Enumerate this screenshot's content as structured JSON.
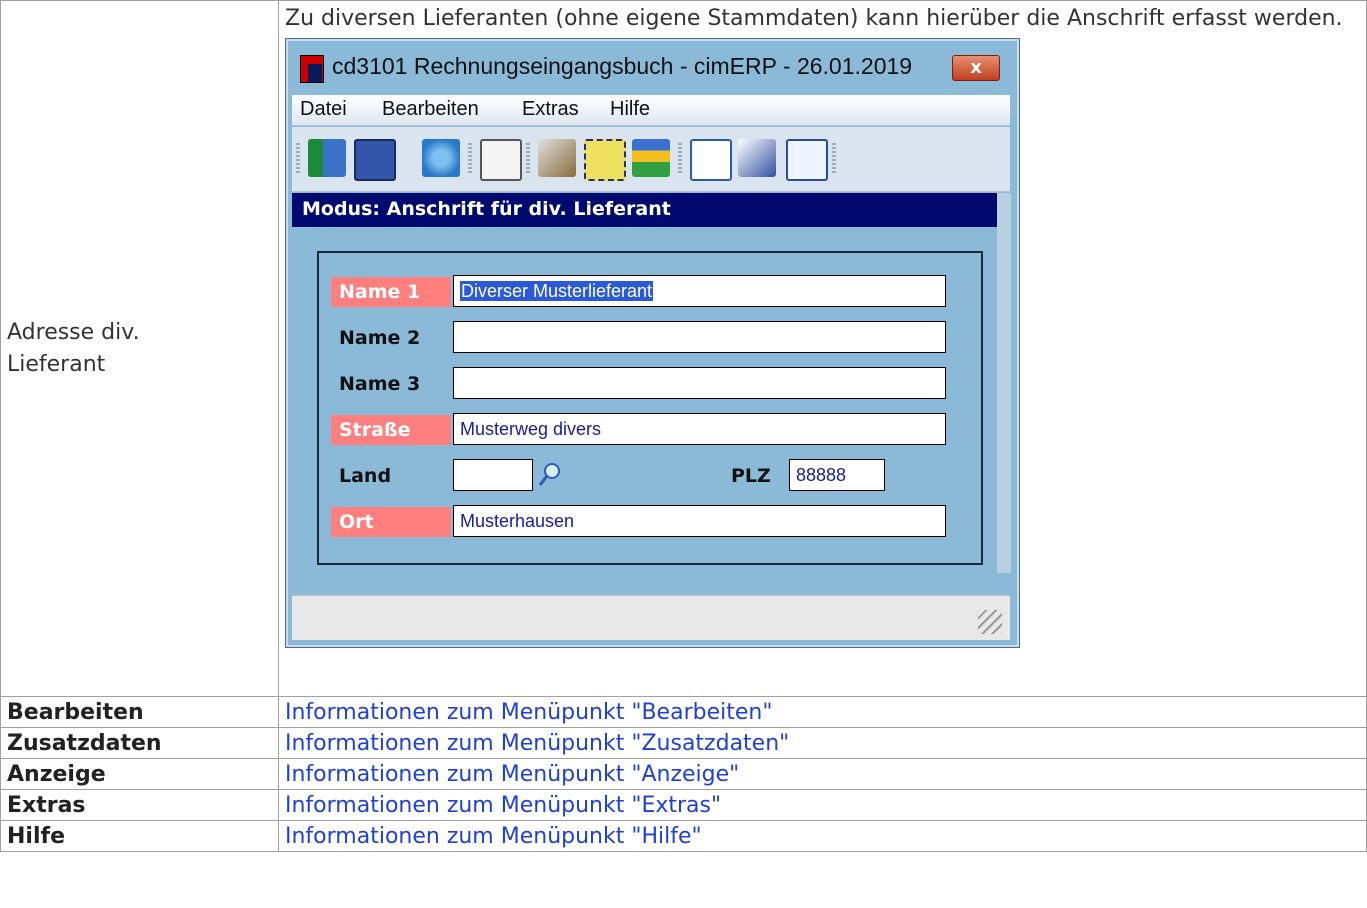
{
  "row_intro": {
    "label": "Adresse div. Lieferant",
    "description": "Zu diversen Lieferanten (ohne eigene Stammdaten) kann hierüber die Anschrift erfasst werden."
  },
  "window": {
    "title": "cd3101 Rechnungseingangsbuch - cimERP - 26.01.2019",
    "close_label": "x",
    "menu": [
      "Datei",
      "Bearbeiten",
      "Extras",
      "Hilfe"
    ],
    "toolbar_icons": [
      "exit-icon",
      "save-icon",
      "recycle-icon",
      "mail-icon",
      "edit-icon",
      "new-record-icon",
      "import-icon",
      "copy-windows-icon",
      "book-icon",
      "grid-icon"
    ],
    "mode": "Modus: Anschrift für div. Lieferant",
    "form": {
      "name1": {
        "label": "Name 1",
        "value": "Diverser Musterlieferant"
      },
      "name2": {
        "label": "Name 2",
        "value": ""
      },
      "name3": {
        "label": "Name 3",
        "value": ""
      },
      "strasse": {
        "label": "Straße",
        "value": "Musterweg divers"
      },
      "land": {
        "label": "Land",
        "value": ""
      },
      "plz": {
        "label": "PLZ",
        "value": "88888"
      },
      "ort": {
        "label": "Ort",
        "value": "Musterhausen"
      }
    },
    "colors": {
      "required_label": "#ff7f7f",
      "mode_bar": "#000a6e",
      "window_bg": "#8bb9d8"
    }
  },
  "rows": [
    {
      "label": "Bearbeiten",
      "link": "Informationen zum Menüpunkt \"Bearbeiten\""
    },
    {
      "label": "Zusatzdaten",
      "link": "Informationen zum Menüpunkt \"Zusatzdaten\""
    },
    {
      "label": "Anzeige",
      "link": "Informationen zum Menüpunkt \"Anzeige\""
    },
    {
      "label": "Extras",
      "link": "Informationen zum Menüpunkt \"Extras\""
    },
    {
      "label": "Hilfe",
      "link": "Informationen zum Menüpunkt \"Hilfe\""
    }
  ]
}
